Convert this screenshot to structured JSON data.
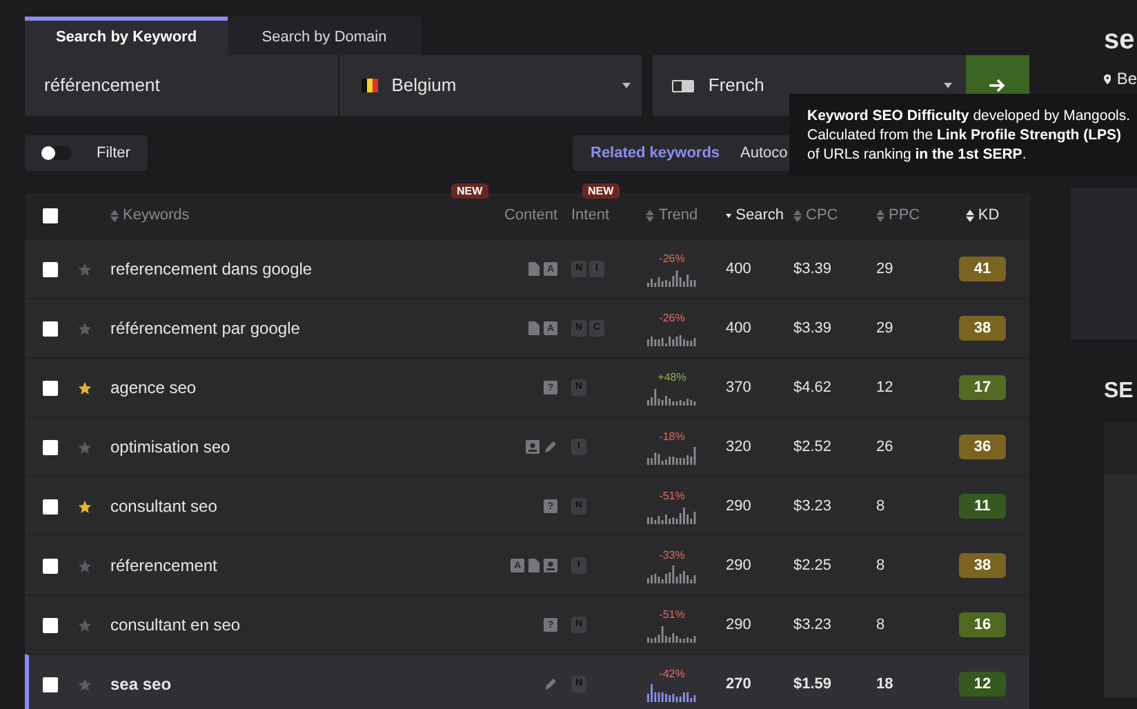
{
  "search_tabs": [
    {
      "label": "Search by Keyword",
      "selected": true
    },
    {
      "label": "Search by Domain",
      "selected": false
    }
  ],
  "search": {
    "value": "référencement",
    "country": "Belgium",
    "language": "French"
  },
  "filter": {
    "label": "Filter",
    "on": false
  },
  "result_tabs": [
    {
      "label": "Related keywords",
      "selected": true
    },
    {
      "label": "Autoco",
      "selected": false
    }
  ],
  "table": {
    "select_all": {
      "checked": false
    },
    "columns": [
      {
        "label": "Keywords",
        "sortable": true,
        "sorted": false,
        "highlighted": false
      },
      {
        "label": "Content",
        "badge": "NEW",
        "sortable": false,
        "highlighted": false
      },
      {
        "label": "Intent",
        "badge": "NEW",
        "sortable": false,
        "highlighted": false
      },
      {
        "label": "Trend",
        "sortable": true,
        "sorted": false,
        "highlighted": false
      },
      {
        "label": "Search",
        "sortable": true,
        "sorted": true,
        "highlighted": true
      },
      {
        "label": "CPC",
        "sortable": true,
        "sorted": false,
        "highlighted": false
      },
      {
        "label": "PPC",
        "sortable": true,
        "sorted": false,
        "highlighted": false
      },
      {
        "label": "KD",
        "sortable": true,
        "sorted": false,
        "highlighted": true
      }
    ],
    "rows": [
      {
        "keyword": "referencement dans google",
        "checked": false,
        "starred": false,
        "selected": false,
        "content": [
          {
            "kind": "doc"
          },
          {
            "kind": "glyph",
            "text": "A"
          }
        ],
        "intent": [
          "N",
          "I"
        ],
        "trend": "-26%",
        "trend_up": false,
        "search": "400",
        "cpc": "$3.39",
        "ppc": "29",
        "kd": "41",
        "color": "#7a6420"
      },
      {
        "keyword": "référencement par google",
        "checked": false,
        "starred": false,
        "selected": false,
        "content": [
          {
            "kind": "doc"
          },
          {
            "kind": "glyph",
            "text": "A"
          }
        ],
        "intent": [
          "N",
          "C"
        ],
        "trend": "-26%",
        "trend_up": false,
        "search": "400",
        "cpc": "$3.39",
        "ppc": "29",
        "kd": "38",
        "color": "#7a6420"
      },
      {
        "keyword": "agence seo",
        "checked": false,
        "starred": true,
        "selected": false,
        "content": [
          {
            "kind": "glyph",
            "text": "?"
          }
        ],
        "intent": [
          "N"
        ],
        "trend": "+48%",
        "trend_up": true,
        "search": "370",
        "cpc": "$4.62",
        "ppc": "12",
        "kd": "17",
        "color": "#556b22"
      },
      {
        "keyword": "optimisation seo",
        "checked": false,
        "starred": false,
        "selected": false,
        "content": [
          {
            "kind": "profile"
          },
          {
            "kind": "pencil"
          }
        ],
        "intent": [
          "I"
        ],
        "trend": "-18%",
        "trend_up": false,
        "search": "320",
        "cpc": "$2.52",
        "ppc": "26",
        "kd": "36",
        "color": "#7a6420"
      },
      {
        "keyword": "consultant seo",
        "checked": false,
        "starred": true,
        "selected": false,
        "content": [
          {
            "kind": "glyph",
            "text": "?"
          }
        ],
        "intent": [
          "N"
        ],
        "trend": "-51%",
        "trend_up": false,
        "search": "290",
        "cpc": "$3.23",
        "ppc": "8",
        "kd": "11",
        "color": "#35591e"
      },
      {
        "keyword": "réferencement",
        "checked": false,
        "starred": false,
        "selected": false,
        "content": [
          {
            "kind": "glyph",
            "text": "A"
          },
          {
            "kind": "doc"
          },
          {
            "kind": "profile"
          }
        ],
        "intent": [
          "I"
        ],
        "trend": "-33%",
        "trend_up": false,
        "search": "290",
        "cpc": "$2.25",
        "ppc": "8",
        "kd": "38",
        "color": "#7a6420"
      },
      {
        "keyword": "consultant en seo",
        "checked": false,
        "starred": false,
        "selected": false,
        "content": [
          {
            "kind": "glyph",
            "text": "?"
          }
        ],
        "intent": [
          "N"
        ],
        "trend": "-51%",
        "trend_up": false,
        "search": "290",
        "cpc": "$3.23",
        "ppc": "8",
        "kd": "16",
        "color": "#4f6a20"
      },
      {
        "keyword": "sea seo",
        "checked": false,
        "starred": false,
        "selected": true,
        "content": [
          {
            "kind": "pencil"
          }
        ],
        "intent": [
          "N"
        ],
        "trend": "-42%",
        "trend_up": false,
        "search": "270",
        "cpc": "$1.59",
        "ppc": "18",
        "kd": "12",
        "color": "#35591e"
      }
    ]
  },
  "tooltip": {
    "text": "**Keyword SEO Difficulty** developed by Mangools. Calculated from the **Link Profile Strength (LPS)** of URLs ranking **in the 1st SERP**."
  },
  "side_panel": {
    "title": "se",
    "location": "Be",
    "serp_heading": "SE"
  }
}
